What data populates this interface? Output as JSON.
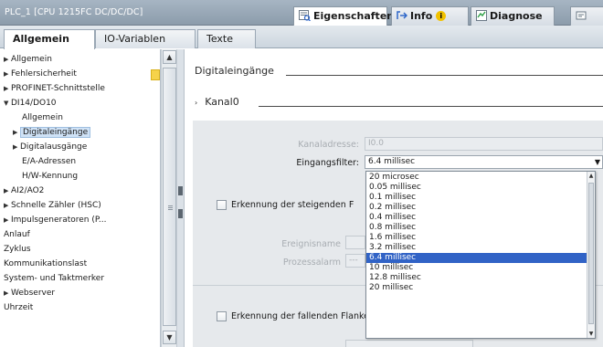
{
  "window": {
    "title": "PLC_1 [CPU 1215FC DC/DC/DC]"
  },
  "inspector_tabs": [
    {
      "label": "Eigenschaften",
      "icon": "properties-icon",
      "active": true
    },
    {
      "label": "Info",
      "icon": "info-icon",
      "badge": "i",
      "active": false
    },
    {
      "label": "Diagnose",
      "icon": "diagnostics-icon",
      "active": false
    },
    {
      "label": "",
      "icon": "overflow-icon",
      "active": false
    }
  ],
  "sub_tabs": [
    {
      "label": "Allgemein",
      "active": true
    },
    {
      "label": "IO-Variablen",
      "active": false
    },
    {
      "label": "Texte",
      "active": false
    }
  ],
  "nav_items": [
    {
      "label": "Allgemein",
      "arrow": "right"
    },
    {
      "label": "Fehlersicherheit",
      "arrow": "right"
    },
    {
      "label": "PROFINET-Schnittstelle",
      "arrow": "right"
    },
    {
      "label": "DI14/DO10",
      "arrow": "down"
    },
    {
      "label": "Allgemein",
      "arrow": ""
    },
    {
      "label": "Digitaleingänge",
      "arrow": "right",
      "selected": true
    },
    {
      "label": "Digitalausgänge",
      "arrow": "right"
    },
    {
      "label": "E/A-Adressen",
      "arrow": ""
    },
    {
      "label": "H/W-Kennung",
      "arrow": ""
    },
    {
      "label": "AI2/AO2",
      "arrow": "right"
    },
    {
      "label": "Schnelle Zähler (HSC)",
      "arrow": "right"
    },
    {
      "label": "Impulsgeneratoren (P...",
      "arrow": "right"
    },
    {
      "label": "Anlauf",
      "arrow": ""
    },
    {
      "label": "Zyklus",
      "arrow": ""
    },
    {
      "label": "Kommunikationslast",
      "arrow": ""
    },
    {
      "label": "System- und Taktmerker",
      "arrow": ""
    },
    {
      "label": "Webserver",
      "arrow": "right"
    },
    {
      "label": "Uhrzeit",
      "arrow": ""
    }
  ],
  "main": {
    "section_title": "Digitaleingänge",
    "channel_label": "Kanal0",
    "channel_address_label": "Kanaladresse:",
    "channel_address_value": "I0.0",
    "input_filter_label": "Eingangsfilter:",
    "input_filter_value": "6.4 millisec",
    "rising_edge_label": "Erkennung der steigenden F",
    "event_name_label": "Ereignisname",
    "process_alarm_label": "Prozessalarm",
    "process_alarm_value": "---",
    "falling_edge_label": "Erkennung der fallenden Flanke aktivieren"
  },
  "filter_options": [
    "20 microsec",
    "0.05 millisec",
    "0.1 millisec",
    "0.2 millisec",
    "0.4 millisec",
    "0.8 millisec",
    "1.6 millisec",
    "3.2 millisec",
    "6.4 millisec",
    "10 millisec",
    "12.8 millisec",
    "20 millisec"
  ],
  "filter_selected_index": 8,
  "colors": {
    "selection": "#3163c6",
    "nav_selection": "#cfe2f6",
    "warning_badge": "#f2c200",
    "panel_gray": "#e6e9ec"
  }
}
